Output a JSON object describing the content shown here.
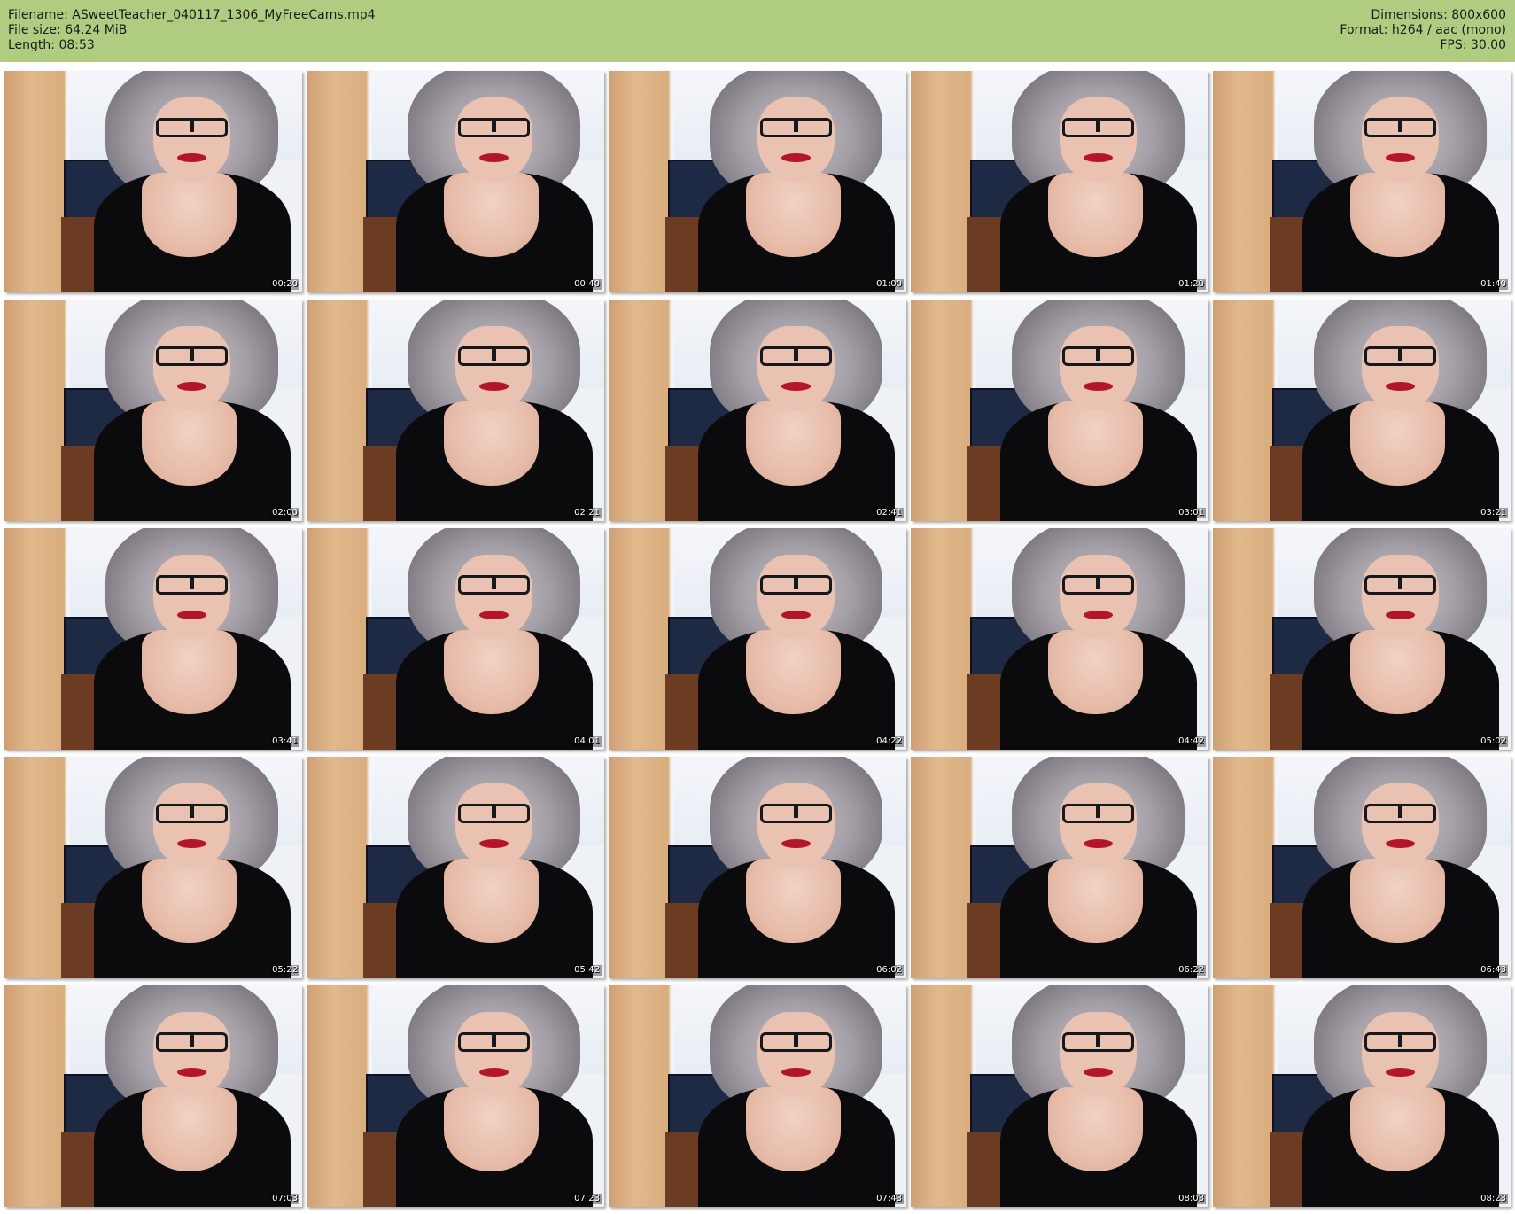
{
  "header": {
    "filename": "Filename: ASweetTeacher_040117_1306_MyFreeCams.mp4",
    "file_size": "File size: 64.24 MiB",
    "length": "Length: 08:53",
    "dimensions": "Dimensions: 800x600",
    "format": "Format: h264 / aac (mono)",
    "fps": "FPS: 30.00"
  },
  "thumbnails": [
    {
      "timestamp": "00:20"
    },
    {
      "timestamp": "00:40"
    },
    {
      "timestamp": "01:00"
    },
    {
      "timestamp": "01:20"
    },
    {
      "timestamp": "01:40"
    },
    {
      "timestamp": "02:00"
    },
    {
      "timestamp": "02:21"
    },
    {
      "timestamp": "02:41"
    },
    {
      "timestamp": "03:01"
    },
    {
      "timestamp": "03:21"
    },
    {
      "timestamp": "03:41"
    },
    {
      "timestamp": "04:01"
    },
    {
      "timestamp": "04:22"
    },
    {
      "timestamp": "04:42"
    },
    {
      "timestamp": "05:02"
    },
    {
      "timestamp": "05:22"
    },
    {
      "timestamp": "05:42"
    },
    {
      "timestamp": "06:02"
    },
    {
      "timestamp": "06:22"
    },
    {
      "timestamp": "06:43"
    },
    {
      "timestamp": "07:03"
    },
    {
      "timestamp": "07:23"
    },
    {
      "timestamp": "07:43"
    },
    {
      "timestamp": "08:03"
    },
    {
      "timestamp": "08:23"
    }
  ],
  "colors": {
    "header_bg": "#b0cc80",
    "background": "#ffffff"
  }
}
